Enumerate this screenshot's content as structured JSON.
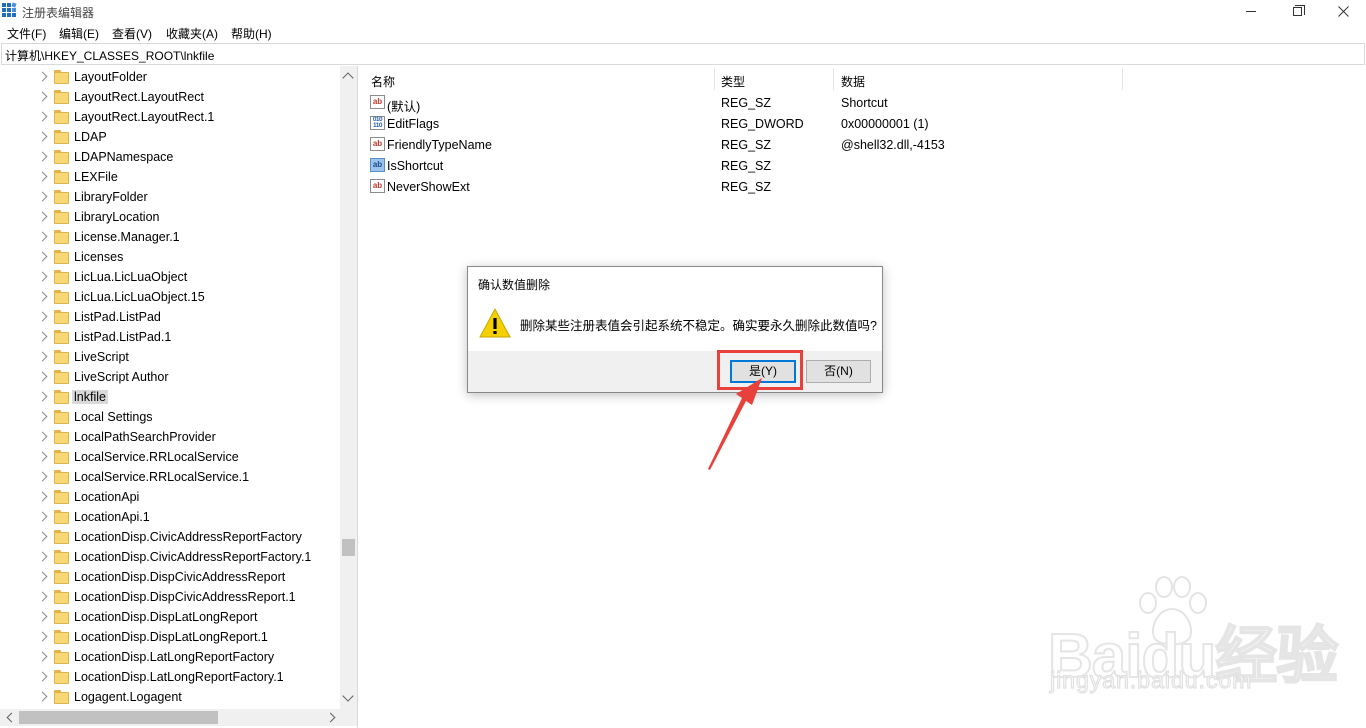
{
  "window": {
    "title": "注册表编辑器",
    "controls": {
      "minimize_icon": "minimize-icon",
      "maximize_icon": "restore-icon",
      "close_icon": "close-icon"
    }
  },
  "menu": [
    {
      "label": "文件(F)"
    },
    {
      "label": "编辑(E)"
    },
    {
      "label": "查看(V)"
    },
    {
      "label": "收藏夹(A)"
    },
    {
      "label": "帮助(H)"
    }
  ],
  "address": {
    "path": "计算机\\HKEY_CLASSES_ROOT\\lnkfile"
  },
  "tree": {
    "items": [
      {
        "label": "LayoutFolder"
      },
      {
        "label": "LayoutRect.LayoutRect"
      },
      {
        "label": "LayoutRect.LayoutRect.1"
      },
      {
        "label": "LDAP"
      },
      {
        "label": "LDAPNamespace"
      },
      {
        "label": "LEXFile"
      },
      {
        "label": "LibraryFolder"
      },
      {
        "label": "LibraryLocation"
      },
      {
        "label": "License.Manager.1"
      },
      {
        "label": "Licenses"
      },
      {
        "label": "LicLua.LicLuaObject"
      },
      {
        "label": "LicLua.LicLuaObject.15"
      },
      {
        "label": "ListPad.ListPad"
      },
      {
        "label": "ListPad.ListPad.1"
      },
      {
        "label": "LiveScript"
      },
      {
        "label": "LiveScript Author"
      },
      {
        "label": "lnkfile",
        "selected": true
      },
      {
        "label": "Local Settings"
      },
      {
        "label": "LocalPathSearchProvider"
      },
      {
        "label": "LocalService.RRLocalService"
      },
      {
        "label": "LocalService.RRLocalService.1"
      },
      {
        "label": "LocationApi"
      },
      {
        "label": "LocationApi.1"
      },
      {
        "label": "LocationDisp.CivicAddressReportFactory"
      },
      {
        "label": "LocationDisp.CivicAddressReportFactory.1"
      },
      {
        "label": "LocationDisp.DispCivicAddressReport"
      },
      {
        "label": "LocationDisp.DispCivicAddressReport.1"
      },
      {
        "label": "LocationDisp.DispLatLongReport"
      },
      {
        "label": "LocationDisp.DispLatLongReport.1"
      },
      {
        "label": "LocationDisp.LatLongReportFactory"
      },
      {
        "label": "LocationDisp.LatLongReportFactory.1"
      },
      {
        "label": "Logagent.Logagent"
      }
    ]
  },
  "values": {
    "columns": {
      "name": "名称",
      "type": "类型",
      "data": "数据"
    },
    "rows": [
      {
        "name": "(默认)",
        "type": "REG_SZ",
        "data": "Shortcut",
        "icon": "string-value-icon"
      },
      {
        "name": "EditFlags",
        "type": "REG_DWORD",
        "data": "0x00000001 (1)",
        "icon": "binary-value-icon"
      },
      {
        "name": "FriendlyTypeName",
        "type": "REG_SZ",
        "data": "@shell32.dll,-4153",
        "icon": "string-value-icon"
      },
      {
        "name": "IsShortcut",
        "type": "REG_SZ",
        "data": "",
        "icon": "string-value-icon"
      },
      {
        "name": "NeverShowExt",
        "type": "REG_SZ",
        "data": "",
        "icon": "string-value-icon"
      }
    ]
  },
  "dialog": {
    "title": "确认数值删除",
    "message": "删除某些注册表值会引起系统不稳定。确实要永久删除此数值吗?",
    "yes_label": "是(Y)",
    "no_label": "否(N)",
    "icon": "warning-icon"
  },
  "watermark": {
    "brand": "Baidu经验",
    "url": "jingyan.baidu.com"
  },
  "colors": {
    "annotation_red": "#e8413b",
    "focus_blue": "#0078d7",
    "folder_yellow": "#f8d775"
  }
}
